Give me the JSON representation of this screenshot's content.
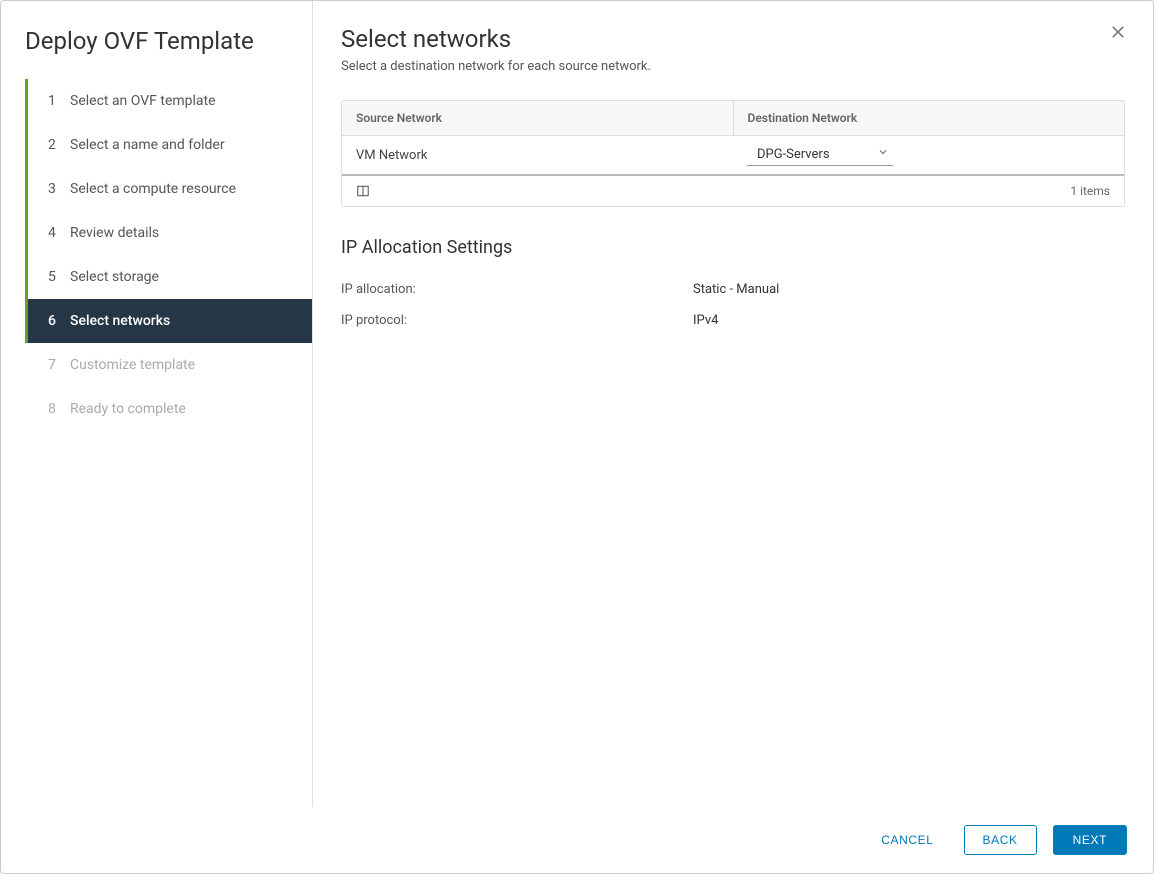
{
  "wizard": {
    "title": "Deploy OVF Template",
    "steps": [
      {
        "num": "1",
        "label": "Select an OVF template",
        "state": "completed"
      },
      {
        "num": "2",
        "label": "Select a name and folder",
        "state": "completed"
      },
      {
        "num": "3",
        "label": "Select a compute resource",
        "state": "completed"
      },
      {
        "num": "4",
        "label": "Review details",
        "state": "completed"
      },
      {
        "num": "5",
        "label": "Select storage",
        "state": "completed"
      },
      {
        "num": "6",
        "label": "Select networks",
        "state": "active"
      },
      {
        "num": "7",
        "label": "Customize template",
        "state": "disabled"
      },
      {
        "num": "8",
        "label": "Ready to complete",
        "state": "disabled"
      }
    ]
  },
  "page": {
    "title": "Select networks",
    "subtitle": "Select a destination network for each source network."
  },
  "networkTable": {
    "headers": {
      "source": "Source Network",
      "destination": "Destination Network"
    },
    "rows": [
      {
        "source": "VM Network",
        "destination": "DPG-Servers"
      }
    ],
    "footer": {
      "count": "1 items"
    }
  },
  "ipSettings": {
    "title": "IP Allocation Settings",
    "allocationLabel": "IP allocation:",
    "allocationValue": "Static - Manual",
    "protocolLabel": "IP protocol:",
    "protocolValue": "IPv4"
  },
  "footer": {
    "cancel": "CANCEL",
    "back": "BACK",
    "next": "NEXT"
  }
}
